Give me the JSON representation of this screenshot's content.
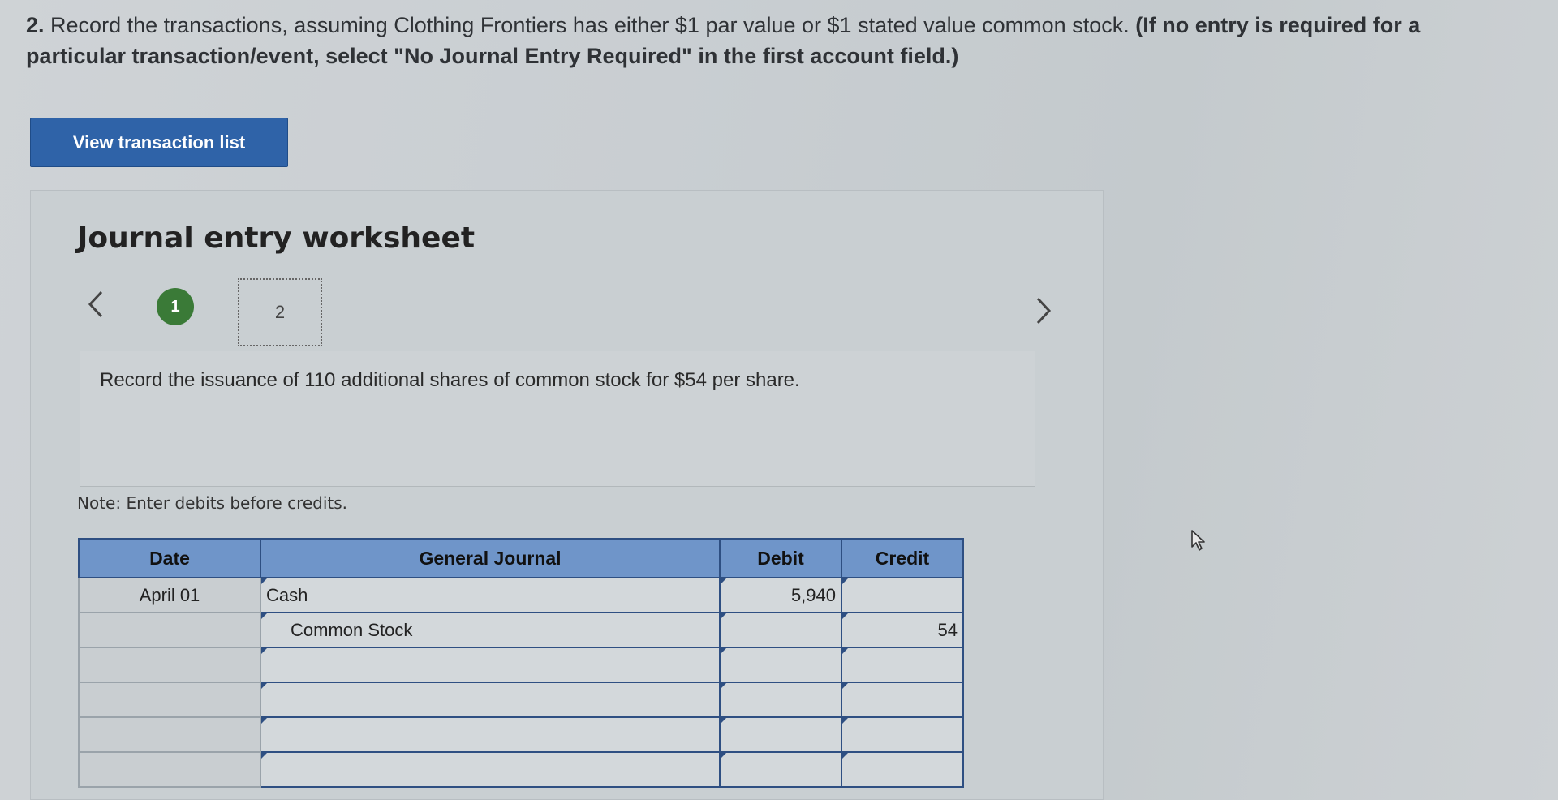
{
  "instructions": {
    "number": "2.",
    "text": "Record the transactions, assuming Clothing Frontiers has either $1 par value or $1 stated value common stock.",
    "bold_note": "(If no entry is required for a particular transaction/event, select \"No Journal Entry Required\" in the first account field.)"
  },
  "view_button_label": "View transaction list",
  "worksheet": {
    "title": "Journal entry worksheet",
    "steps": [
      "1",
      "2"
    ],
    "current_step": "2",
    "prompt": "Record the issuance of 110 additional shares of common stock for $54 per share.",
    "note": "Note: Enter debits before credits."
  },
  "journal": {
    "headers": {
      "date": "Date",
      "account": "General Journal",
      "debit": "Debit",
      "credit": "Credit"
    },
    "rows": [
      {
        "date": "April 01",
        "account": "Cash",
        "debit": "5,940",
        "credit": ""
      },
      {
        "date": "",
        "account": "Common Stock",
        "debit": "",
        "credit": "54"
      },
      {
        "date": "",
        "account": "",
        "debit": "",
        "credit": ""
      },
      {
        "date": "",
        "account": "",
        "debit": "",
        "credit": ""
      },
      {
        "date": "",
        "account": "",
        "debit": "",
        "credit": ""
      },
      {
        "date": "",
        "account": "",
        "debit": "",
        "credit": ""
      }
    ]
  },
  "colors": {
    "button": "#2f63a8",
    "table_header": "#6f95c9",
    "step_completed": "#3a7a37"
  },
  "icons": {
    "prev": "chevron-left-icon",
    "next": "chevron-right-icon",
    "cursor": "mouse-pointer-icon"
  }
}
